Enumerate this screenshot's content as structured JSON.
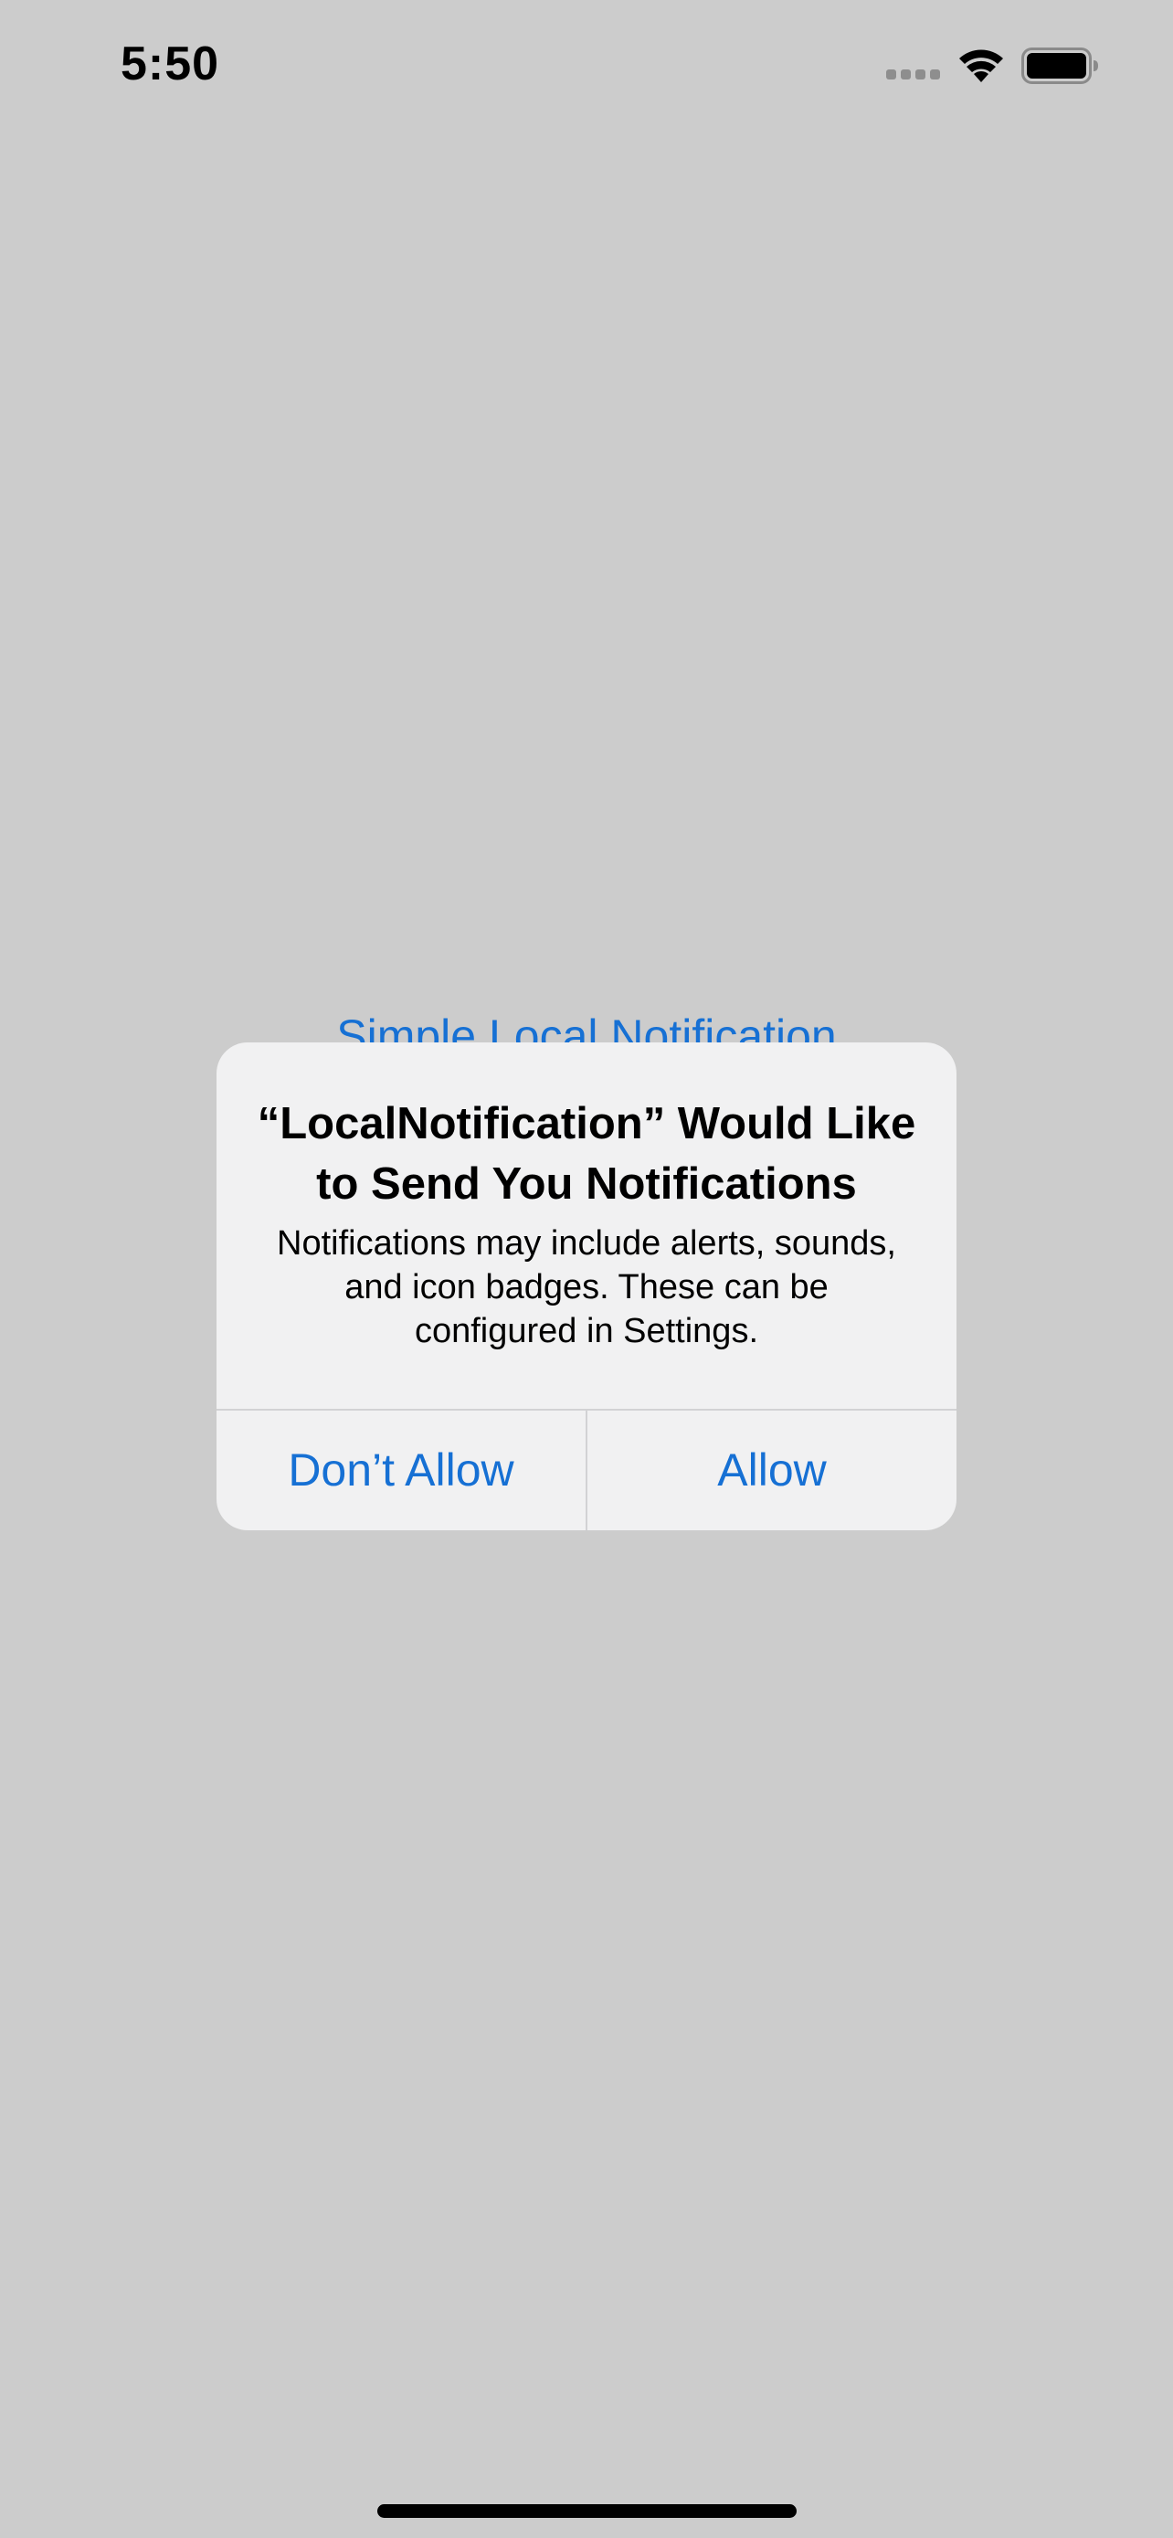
{
  "status_bar": {
    "time": "5:50",
    "signal_icon": "cellular-signal-icon",
    "wifi_icon": "wifi-icon",
    "battery_icon": "battery-icon"
  },
  "background": {
    "link_text": "Simple Local Notification"
  },
  "alert": {
    "title": "“LocalNotification” Would Like to Send You Notifications",
    "message": "Notifications may include alerts, sounds, and icon badges. These can be configured in Settings.",
    "buttons": [
      {
        "label": "Don’t Allow"
      },
      {
        "label": "Allow"
      }
    ]
  },
  "colors": {
    "dimmed_background": "#cccccc",
    "alert_background": "#f1f1f2",
    "accent": "#1670d4",
    "divider": "#d2d2d4",
    "signal_inactive": "#8e8e8e"
  }
}
